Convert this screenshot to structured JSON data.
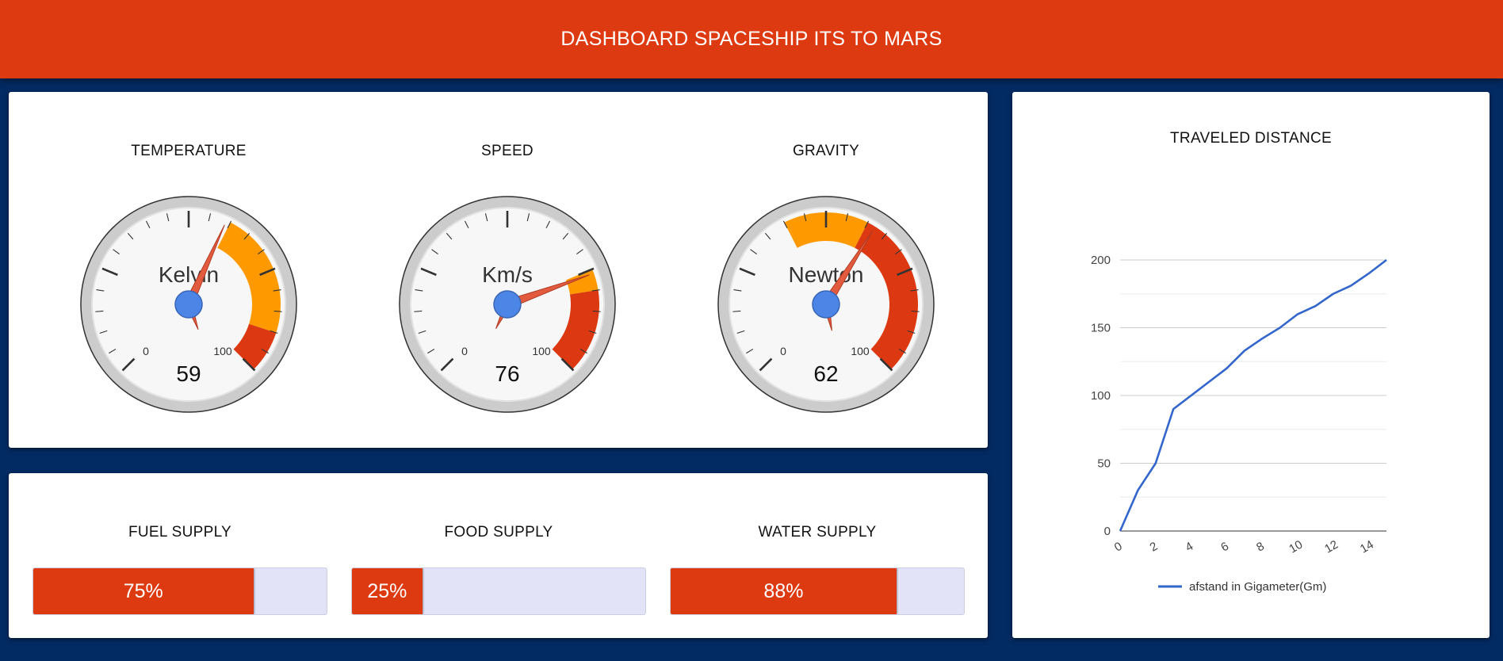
{
  "header": {
    "title": "DASHBOARD SPACESHIP ITS TO MARS"
  },
  "gauges": [
    {
      "title": "TEMPERATURE",
      "unit": "Kelvin",
      "value": "59",
      "min_label": "0",
      "max_label": "100"
    },
    {
      "title": "SPEED",
      "unit": "Km/s",
      "value": "76",
      "min_label": "0",
      "max_label": "100"
    },
    {
      "title": "GRAVITY",
      "unit": "Newton",
      "value": "62",
      "min_label": "0",
      "max_label": "100"
    }
  ],
  "gauge_values": [
    59,
    76,
    62
  ],
  "gauge_zones": [
    {
      "yellow": [
        60,
        90
      ],
      "red": [
        90,
        100
      ]
    },
    {
      "yellow": [
        75,
        80
      ],
      "red": [
        80,
        100
      ]
    },
    {
      "yellow": [
        40,
        60
      ],
      "red": [
        60,
        100
      ]
    }
  ],
  "supplies": [
    {
      "title": "FUEL SUPPLY",
      "label": "75%",
      "fraction": 0.75
    },
    {
      "title": "FOOD SUPPLY",
      "label": "25%",
      "fraction": 0.24
    },
    {
      "title": "WATER SUPPLY",
      "label": "88%",
      "fraction": 0.77
    }
  ],
  "colors": {
    "accent": "#de3a12",
    "background": "#032b63",
    "needle": "#e35b3f",
    "gauge_yellow": "#ff9900",
    "gauge_red": "#dc3912",
    "line": "#3366cc"
  },
  "chart_data": {
    "type": "line",
    "title": "TRAVELED DISTANCE",
    "series": [
      {
        "name": "afstand in Gigameter(Gm)",
        "x": [
          0,
          1,
          2,
          3,
          4,
          5,
          6,
          7,
          8,
          9,
          10,
          11,
          12,
          13,
          14,
          15
        ],
        "values": [
          0,
          30,
          50,
          90,
          100,
          110,
          120,
          133,
          142,
          150,
          160,
          166,
          175,
          181,
          190,
          200
        ]
      }
    ],
    "x_ticks": [
      "0",
      "2",
      "4",
      "6",
      "8",
      "10",
      "12",
      "14"
    ],
    "y_ticks": [
      "0",
      "50",
      "100",
      "150",
      "200"
    ],
    "xlim": [
      0,
      15
    ],
    "ylim": [
      0,
      200
    ],
    "grid": true,
    "legend": "bottom"
  }
}
